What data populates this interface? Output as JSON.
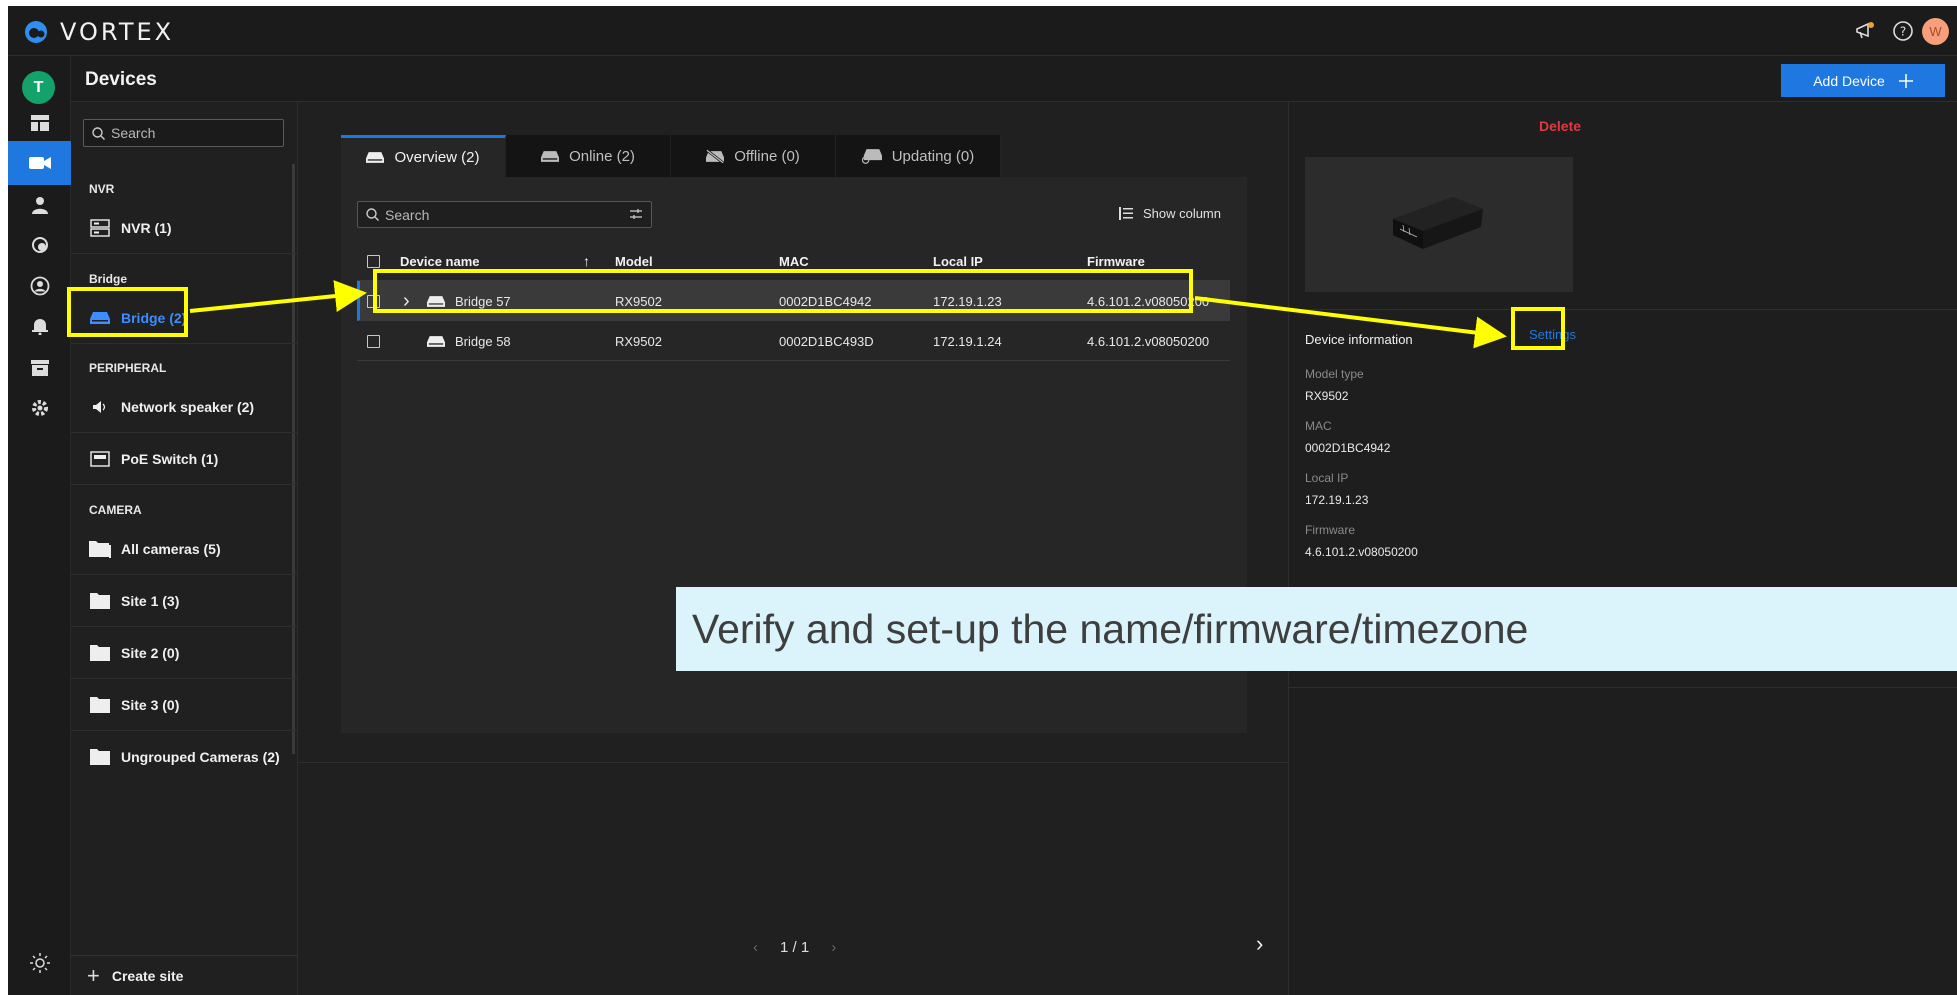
{
  "app": {
    "brand": "VORTEX"
  },
  "topbar": {
    "user_initial": "W"
  },
  "rail": {
    "user_initial": "T"
  },
  "header": {
    "title": "Devices",
    "add_device_label": "Add Device"
  },
  "sidebar": {
    "search_placeholder": "Search",
    "sections": {
      "nvr": "NVR",
      "bridge": "Bridge",
      "peripheral": "PERIPHERAL",
      "camera": "CAMERA"
    },
    "items": [
      {
        "label": "NVR (1)"
      },
      {
        "label": "Bridge (2)"
      },
      {
        "label": "Network speaker (2)"
      },
      {
        "label": "PoE Switch (1)"
      },
      {
        "label": "All cameras (5)"
      },
      {
        "label": "Site 1 (3)"
      },
      {
        "label": "Site 2 (0)"
      },
      {
        "label": "Site 3 (0)"
      },
      {
        "label": "Ungrouped Cameras (2)"
      }
    ],
    "create_site_label": "Create site"
  },
  "tabs": [
    {
      "label": "Overview (2)"
    },
    {
      "label": "Online (2)"
    },
    {
      "label": "Offline (0)"
    },
    {
      "label": "Updating (0)"
    }
  ],
  "table": {
    "search_placeholder": "Search",
    "show_column_label": "Show column",
    "headers": {
      "device_name": "Device name",
      "sort": "↑",
      "model": "Model",
      "mac": "MAC",
      "local_ip": "Local IP",
      "firmware": "Firmware"
    },
    "rows": [
      {
        "expand": "›",
        "name": "Bridge 57",
        "model": "RX9502",
        "mac": "0002D1BC4942",
        "ip": "172.19.1.23",
        "firmware": "4.6.101.2.v08050200"
      },
      {
        "name": "Bridge 58",
        "model": "RX9502",
        "mac": "0002D1BC493D",
        "ip": "172.19.1.24",
        "firmware": "4.6.101.2.v08050200"
      }
    ]
  },
  "pagination": {
    "prev": "‹",
    "label": "1 / 1",
    "next": "›",
    "panel_next": "›"
  },
  "detail": {
    "delete_label": "Delete",
    "info_title": "Device information",
    "settings_label": "Settings",
    "fields": [
      {
        "label": "Model type",
        "value": "RX9502"
      },
      {
        "label": "MAC",
        "value": "0002D1BC4942"
      },
      {
        "label": "Local IP",
        "value": "172.19.1.23"
      },
      {
        "label": "Firmware",
        "value": "4.6.101.2.v08050200"
      }
    ]
  },
  "annotation": {
    "caption": "Verify and set-up the name/firmware/timezone",
    "highlight_color": "#ffff00"
  },
  "colors": {
    "accent": "#1e78e0",
    "danger": "#e0393e",
    "avatar_t": "#13a36a",
    "avatar_w": "#f5a07a"
  }
}
